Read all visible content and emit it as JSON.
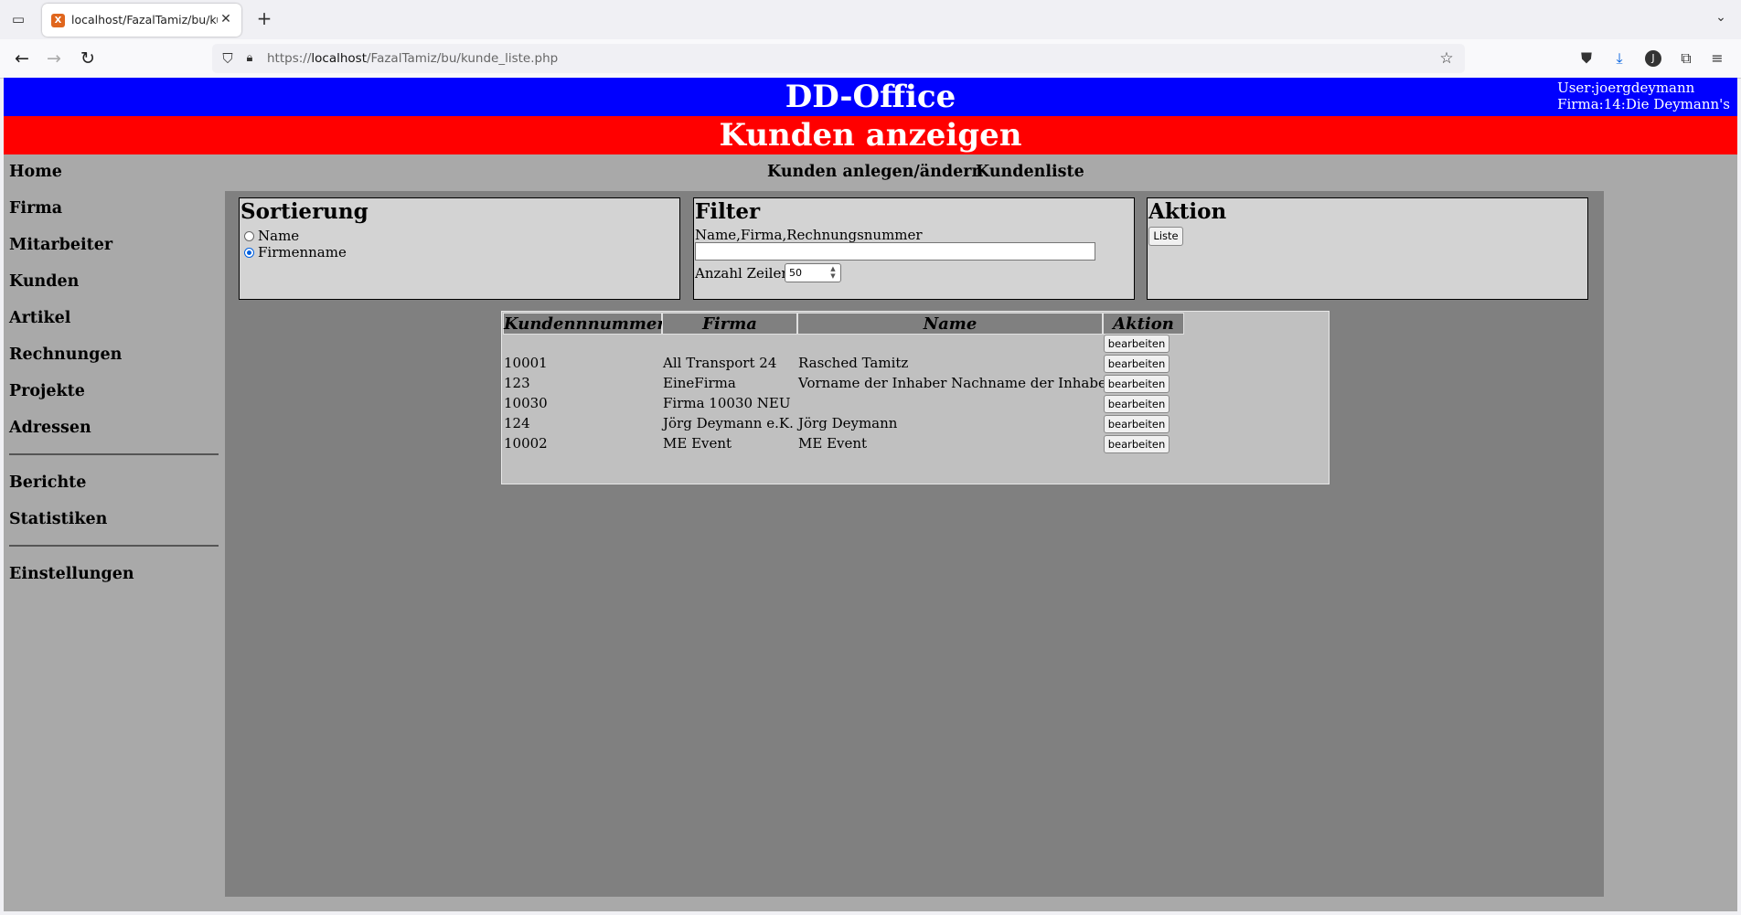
{
  "browser": {
    "tab_title": "localhost/FazalTamiz/bu/kunde_liste.php",
    "url_prefix": "https://",
    "url_host": "localhost",
    "url_path": "/FazalTamiz/bu/kunde_liste.php",
    "favicon_letter": "X"
  },
  "header": {
    "app_title": "DD-Office",
    "user_line": "User:joergdeymann",
    "firma_line": "Firma:14:Die Deymann's",
    "page_title": "Kunden anzeigen",
    "colors": {
      "top_bar": "#0000ff",
      "title_bar": "#ff0000"
    }
  },
  "sidebar": {
    "items": [
      "Home",
      "Firma",
      "Mitarbeiter",
      "Kunden",
      "Artikel",
      "Rechnungen",
      "Projekte",
      "Adressen"
    ],
    "reports": [
      "Berichte",
      "Statistiken"
    ],
    "settings": "Einstellungen"
  },
  "topnav": {
    "create_link": "Kunden anlegen/ändern",
    "list_link": "Kundenliste"
  },
  "sort_panel": {
    "title": "Sortierung",
    "options": [
      "Name",
      "Firmenname"
    ],
    "selected": "Firmenname"
  },
  "filter_panel": {
    "title": "Filter",
    "search_label": "Name,Firma,Rechnungsnummer",
    "search_value": "",
    "rows_label": "Anzahl Zeilen:",
    "rows_value": "50"
  },
  "action_panel": {
    "title": "Aktion",
    "list_button": "Liste"
  },
  "table": {
    "headers": [
      "Kundennnummer",
      "Firma",
      "Name",
      "Aktion"
    ],
    "edit_label": "bearbeiten",
    "rows": [
      {
        "nr": "",
        "firma": "",
        "name": ""
      },
      {
        "nr": "10001",
        "firma": "All Transport 24",
        "name": "Rasched Tamitz"
      },
      {
        "nr": "123",
        "firma": "EineFirma",
        "name": "Vorname der Inhaber Nachname der Inhaber"
      },
      {
        "nr": "10030",
        "firma": "Firma 10030 NEU",
        "name": ""
      },
      {
        "nr": "124",
        "firma": "Jörg Deymann e.K.",
        "name": "Jörg Deymann"
      },
      {
        "nr": "10002",
        "firma": "ME Event",
        "name": "ME Event"
      }
    ]
  }
}
